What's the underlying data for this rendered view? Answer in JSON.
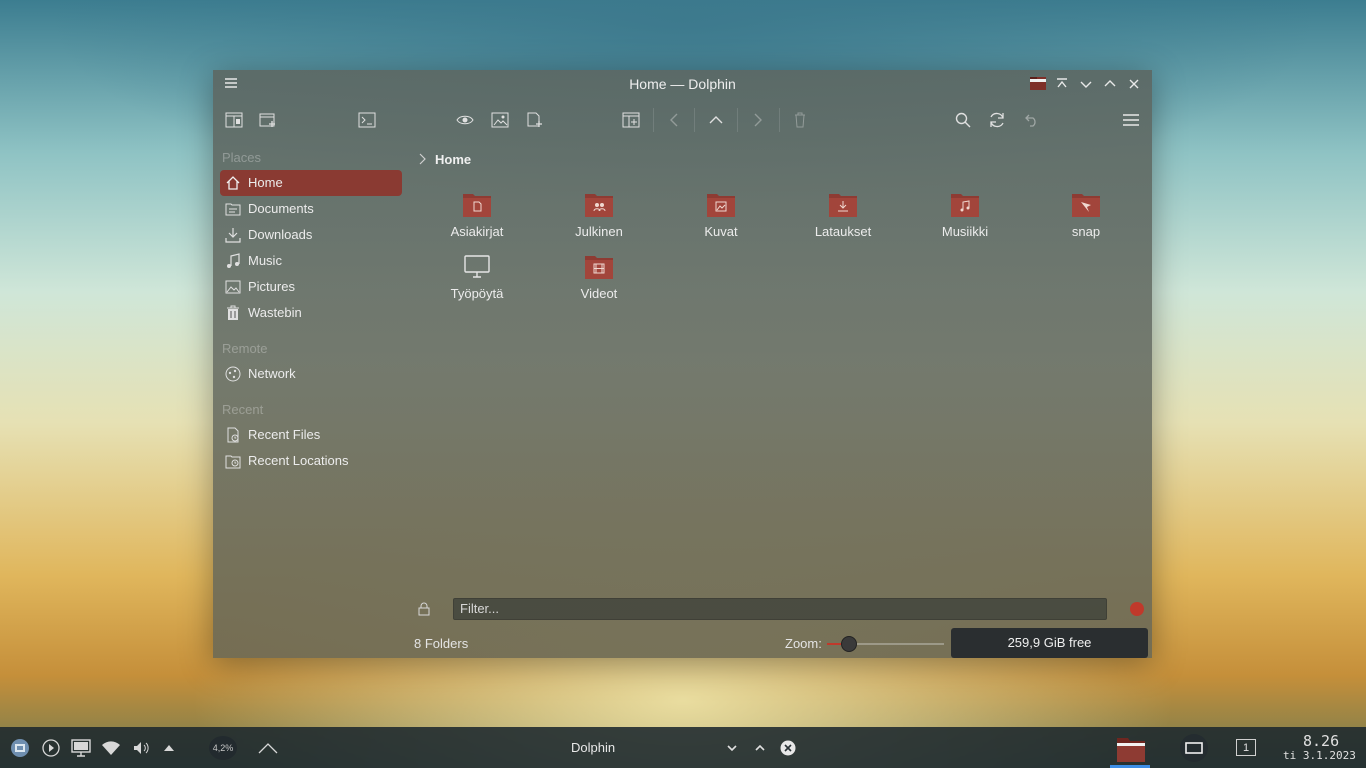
{
  "window": {
    "title": "Home — Dolphin"
  },
  "sidebar": {
    "sections": {
      "places": "Places",
      "remote": "Remote",
      "recent": "Recent"
    },
    "items": [
      {
        "label": "Home",
        "icon": "home-icon",
        "active": true
      },
      {
        "label": "Documents",
        "icon": "documents-icon"
      },
      {
        "label": "Downloads",
        "icon": "downloads-icon"
      },
      {
        "label": "Music",
        "icon": "music-icon"
      },
      {
        "label": "Pictures",
        "icon": "pictures-icon"
      },
      {
        "label": "Wastebin",
        "icon": "trash-icon"
      },
      {
        "label": "Network",
        "icon": "network-icon"
      },
      {
        "label": "Recent Files",
        "icon": "recent-files-icon"
      },
      {
        "label": "Recent Locations",
        "icon": "recent-locations-icon"
      }
    ]
  },
  "breadcrumb": {
    "current": "Home"
  },
  "folders": [
    {
      "name": "Asiakirjat",
      "icon": "documents-folder-icon"
    },
    {
      "name": "Julkinen",
      "icon": "public-folder-icon"
    },
    {
      "name": "Kuvat",
      "icon": "pictures-folder-icon"
    },
    {
      "name": "Lataukset",
      "icon": "downloads-folder-icon"
    },
    {
      "name": "Musiikki",
      "icon": "music-folder-icon"
    },
    {
      "name": "snap",
      "icon": "snap-folder-icon"
    },
    {
      "name": "Työpöytä",
      "icon": "desktop-icon"
    },
    {
      "name": "Videot",
      "icon": "videos-folder-icon"
    }
  ],
  "filter": {
    "placeholder": "Filter..."
  },
  "statusbar": {
    "count": "8 Folders",
    "zoom_label": "Zoom:",
    "zoom_level": 0.18,
    "free_space": "259,9 GiB free"
  },
  "taskbar": {
    "cpu": "4,2%",
    "active_task": "Dolphin",
    "desktop_number": "1",
    "time": "8.26",
    "date": "ti 3.1.2023"
  },
  "colors": {
    "accent": "#8a3a32",
    "folder": "#8e3b33"
  }
}
